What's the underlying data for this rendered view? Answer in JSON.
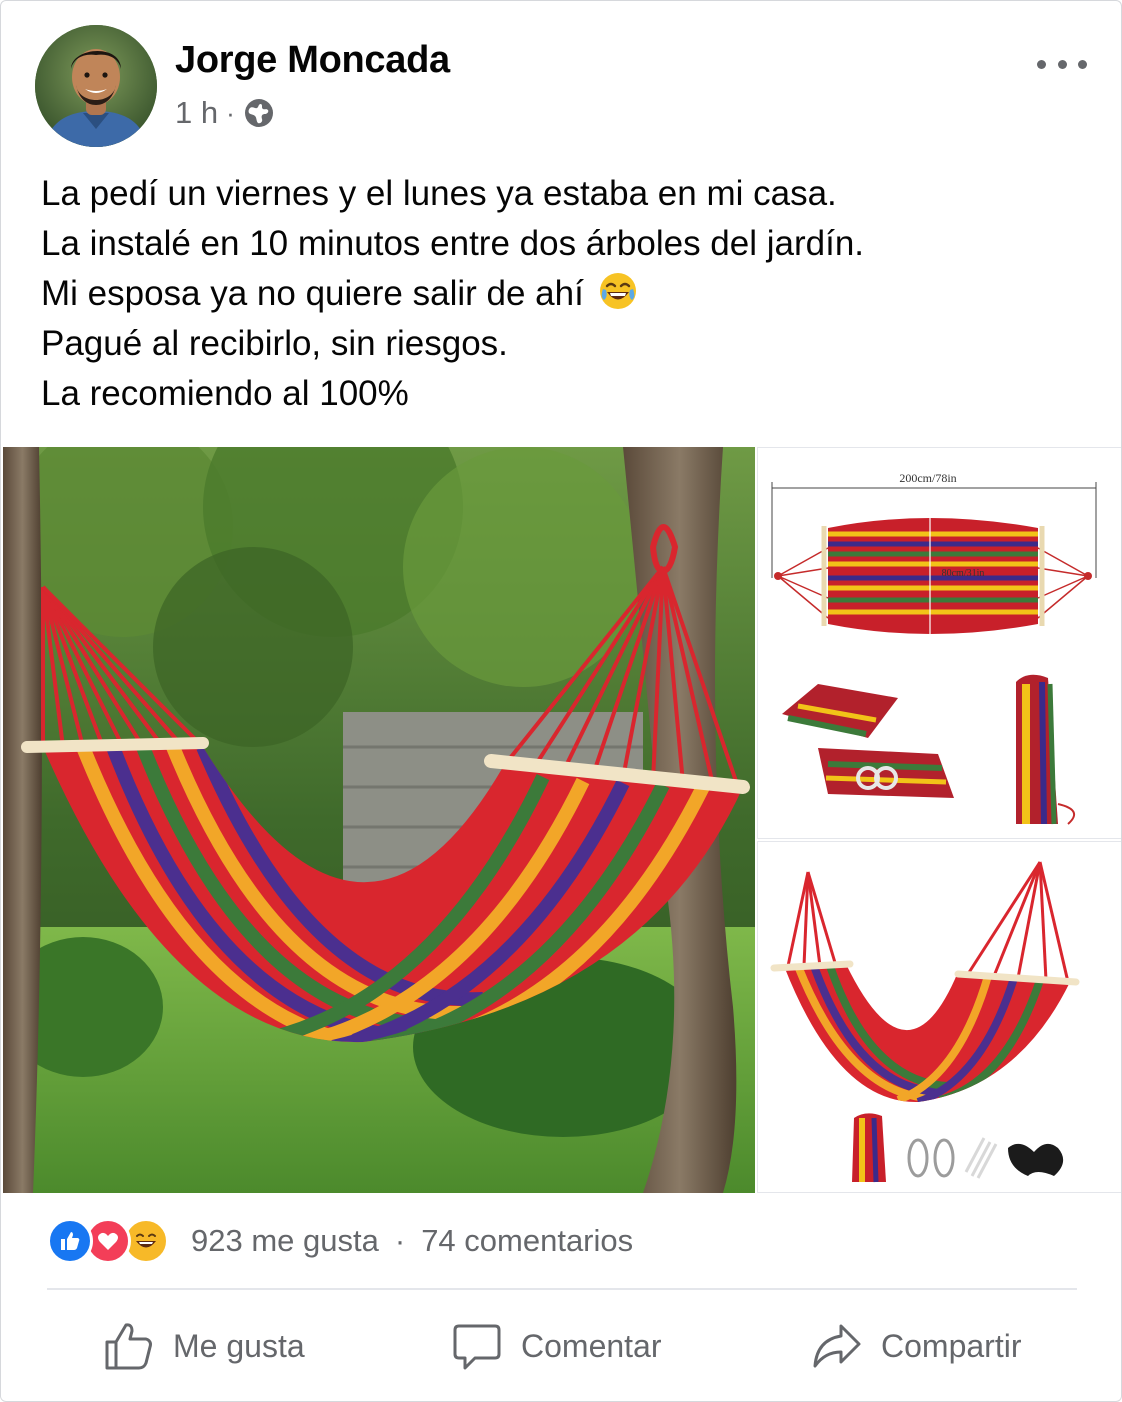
{
  "post": {
    "author": "Jorge Moncada",
    "time": "1 h",
    "separator": "·",
    "privacy_icon": "globe-icon",
    "more_icon": "more-horizontal-icon",
    "text_lines": [
      "La pedí un viernes y el lunes ya estaba en mi casa.",
      "La instalé en 10 minutos entre dos árboles del jardín.",
      "Mi esposa ya no quiere salir de ahí",
      "Pagué al recibirlo, sin riesgos.",
      "La recomiendo al 100%"
    ],
    "emoji": "face-with-tears-of-joy"
  },
  "gallery": {
    "main_photo": "rainbow-striped-hammock-between-trees",
    "thumb1": {
      "width_label": "200cm/78in",
      "height_label": "80cm/31in"
    },
    "thumb2": "hammock-with-accessories"
  },
  "engagement": {
    "reactions": [
      "like",
      "love",
      "haha"
    ],
    "likes": "923 me gusta",
    "dot": "·",
    "comments": "74 comentarios"
  },
  "actions": {
    "like": "Me gusta",
    "comment": "Comentar",
    "share": "Compartir"
  },
  "colors": {
    "like_blue": "#1877f2",
    "love_red": "#f33e58",
    "haha_yellow": "#f7b928",
    "secondary_text": "#65676b"
  }
}
